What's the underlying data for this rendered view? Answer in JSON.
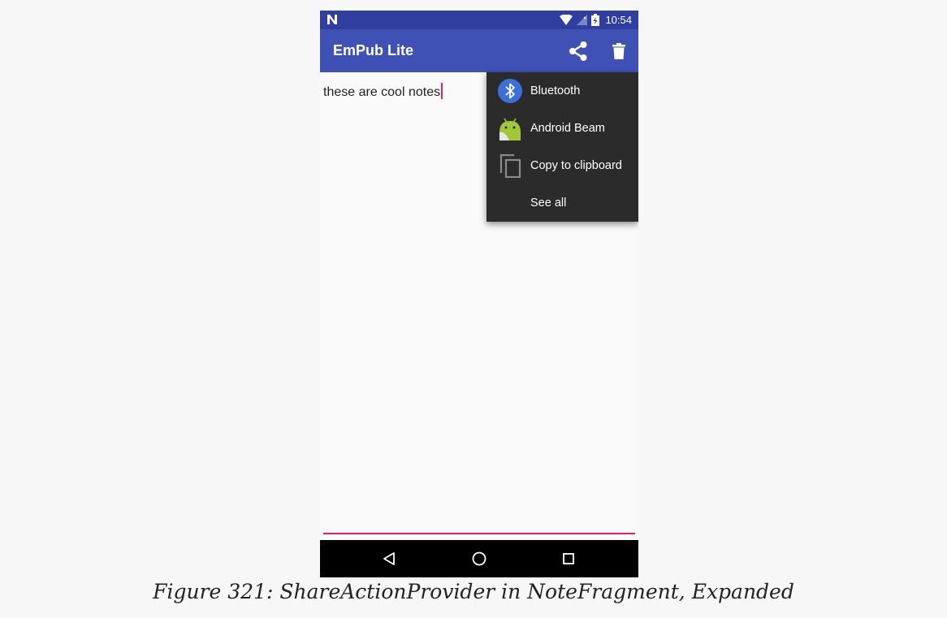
{
  "status_bar": {
    "time": "10:54",
    "icons": [
      "n-notification-icon",
      "wifi-icon",
      "signal-icon",
      "battery-charging-icon"
    ]
  },
  "app_bar": {
    "title": "EmPub Lite",
    "actions": [
      "share-icon",
      "delete-icon"
    ]
  },
  "editor": {
    "text": "these are cool notes"
  },
  "share_menu": {
    "items": [
      {
        "label": "Bluetooth",
        "icon": "bluetooth-icon"
      },
      {
        "label": "Android Beam",
        "icon": "android-beam-icon"
      },
      {
        "label": "Copy to clipboard",
        "icon": "copy-icon"
      },
      {
        "label": "See all",
        "icon": ""
      }
    ]
  },
  "nav_bar": {
    "buttons": [
      "back-icon",
      "home-icon",
      "recents-icon"
    ]
  },
  "caption": "Figure 321: ShareActionProvider in NoteFragment, Expanded",
  "colors": {
    "primary": "#3f51b5",
    "primary_dark": "#303f9f",
    "accent": "#e91e63",
    "menu_bg": "#2b2b2b"
  }
}
